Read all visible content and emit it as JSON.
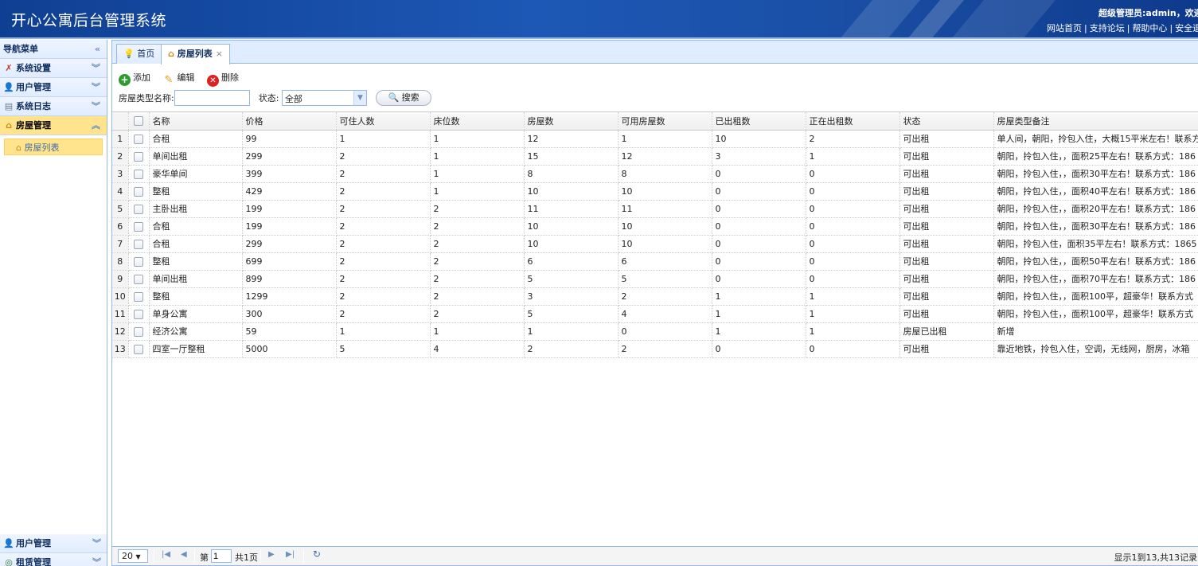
{
  "header": {
    "title": "开心公寓后台管理系统",
    "user_line": "超级管理员:admin，欢迎您",
    "links": [
      "网站首页",
      "支持论坛",
      "帮助中心",
      "安全退出"
    ]
  },
  "sidebar": {
    "nav_title": "导航菜单",
    "collapse_icon": "«",
    "items": [
      {
        "label": "系统设置",
        "tool": "︾"
      },
      {
        "label": "用户管理",
        "tool": "︾"
      },
      {
        "label": "系统日志",
        "tool": "︾"
      },
      {
        "label": "房屋管理",
        "tool": "︽"
      }
    ],
    "sub_items": [
      {
        "label": "房屋列表"
      }
    ],
    "bottom_items": [
      {
        "label": "用户管理",
        "tool": "︾"
      },
      {
        "label": "租赁管理",
        "tool": "︾"
      }
    ]
  },
  "tabs": [
    {
      "label": "首页"
    },
    {
      "label": "房屋列表",
      "close": "×"
    }
  ],
  "toolbar": {
    "add": "添加",
    "edit": "编辑",
    "delete": "删除"
  },
  "search": {
    "type_label": "房屋类型名称:",
    "type_value": "",
    "status_label": "状态:",
    "status_value": "全部",
    "button": "搜索"
  },
  "grid": {
    "columns": [
      "名称",
      "价格",
      "可住人数",
      "床位数",
      "房屋数",
      "可用房屋数",
      "已出租数",
      "正在出租数",
      "状态",
      "房屋类型备注"
    ],
    "rows": [
      {
        "n": "1",
        "c": [
          "合租",
          "99",
          "1",
          "1",
          "12",
          "1",
          "10",
          "2",
          "可出租",
          "单人间，朝阳，拎包入住，大概15平米左右！联系方"
        ]
      },
      {
        "n": "2",
        "c": [
          "单间出租",
          "299",
          "2",
          "1",
          "15",
          "12",
          "3",
          "1",
          "可出租",
          "朝阳，拎包入住，，面积25平左右！联系方式：186"
        ]
      },
      {
        "n": "3",
        "c": [
          "豪华单间",
          "399",
          "2",
          "1",
          "8",
          "8",
          "0",
          "0",
          "可出租",
          "朝阳，拎包入住，，面积30平左右！联系方式：186"
        ]
      },
      {
        "n": "4",
        "c": [
          "整租",
          "429",
          "2",
          "1",
          "10",
          "10",
          "0",
          "0",
          "可出租",
          "朝阳，拎包入住，，面积40平左右！联系方式：186"
        ]
      },
      {
        "n": "5",
        "c": [
          "主卧出租",
          "199",
          "2",
          "2",
          "11",
          "11",
          "0",
          "0",
          "可出租",
          "朝阳，拎包入住，，面积20平左右！联系方式：186"
        ]
      },
      {
        "n": "6",
        "c": [
          "合租",
          "199",
          "2",
          "2",
          "10",
          "10",
          "0",
          "0",
          "可出租",
          "朝阳，拎包入住，，面积30平左右！联系方式：186"
        ]
      },
      {
        "n": "7",
        "c": [
          "合租",
          "299",
          "2",
          "2",
          "10",
          "10",
          "0",
          "0",
          "可出租",
          "朝阳，拎包入住，面积35平左右！联系方式：1865"
        ]
      },
      {
        "n": "8",
        "c": [
          "整租",
          "699",
          "2",
          "2",
          "6",
          "6",
          "0",
          "0",
          "可出租",
          "朝阳，拎包入住，，面积50平左右！联系方式：186"
        ]
      },
      {
        "n": "9",
        "c": [
          "单间出租",
          "899",
          "2",
          "2",
          "5",
          "5",
          "0",
          "0",
          "可出租",
          "朝阳，拎包入住，，面积70平左右！联系方式：186"
        ]
      },
      {
        "n": "10",
        "c": [
          "整租",
          "1299",
          "2",
          "2",
          "3",
          "2",
          "1",
          "1",
          "可出租",
          "朝阳，拎包入住，，面积100平，超豪华！联系方式"
        ]
      },
      {
        "n": "11",
        "c": [
          "单身公寓",
          "300",
          "2",
          "2",
          "5",
          "4",
          "1",
          "1",
          "可出租",
          "朝阳，拎包入住，，面积100平，超豪华！联系方式"
        ]
      },
      {
        "n": "12",
        "c": [
          "经济公寓",
          "59",
          "1",
          "1",
          "1",
          "0",
          "1",
          "1",
          "房屋已出租",
          "新增"
        ]
      },
      {
        "n": "13",
        "c": [
          "四室一厅整租",
          "5000",
          "5",
          "4",
          "2",
          "2",
          "0",
          "0",
          "可出租",
          "靠近地铁，拎包入住，空调，无线网，厨房，冰箱"
        ]
      }
    ]
  },
  "pager": {
    "page_size": "20",
    "page_label": "第",
    "page_value": "1",
    "total_pages": "共1页",
    "info": "显示1到13,共13记录"
  },
  "colors": {
    "header": "#1d58b6",
    "border": "#95b8e7",
    "active": "#ffe48d"
  }
}
